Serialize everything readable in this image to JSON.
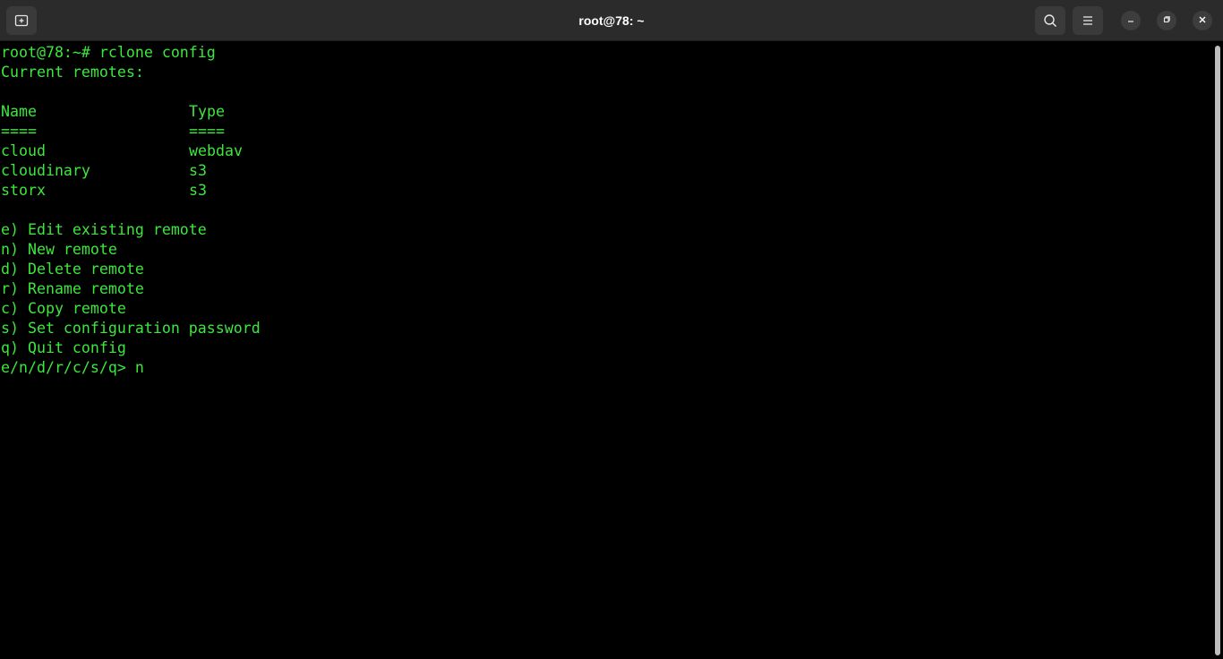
{
  "window": {
    "title": "root@78: ~"
  },
  "titlebar": {
    "new_tab_icon": "new-tab-icon",
    "search_icon": "search-icon",
    "menu_icon": "hamburger-menu-icon",
    "minimize_icon": "minimize-icon",
    "maximize_icon": "restore-icon",
    "close_icon": "close-icon"
  },
  "colors": {
    "text": "#3ee63e",
    "background": "#000000",
    "titlebar": "#2b2b2b"
  },
  "terminal": {
    "prompt_line": "root@78:~# rclone config",
    "current_remotes": "Current remotes:",
    "table": {
      "headers": [
        "Name",
        "Type"
      ],
      "separators": [
        "====",
        "===="
      ],
      "rows": [
        {
          "name": "cloud",
          "type": "webdav"
        },
        {
          "name": "cloudinary",
          "type": "s3"
        },
        {
          "name": "storx",
          "type": "s3"
        }
      ]
    },
    "menu": [
      "e) Edit existing remote",
      "n) New remote",
      "d) Delete remote",
      "r) Rename remote",
      "c) Copy remote",
      "s) Set configuration password",
      "q) Quit config"
    ],
    "input_prompt": "e/n/d/r/c/s/q> n"
  }
}
